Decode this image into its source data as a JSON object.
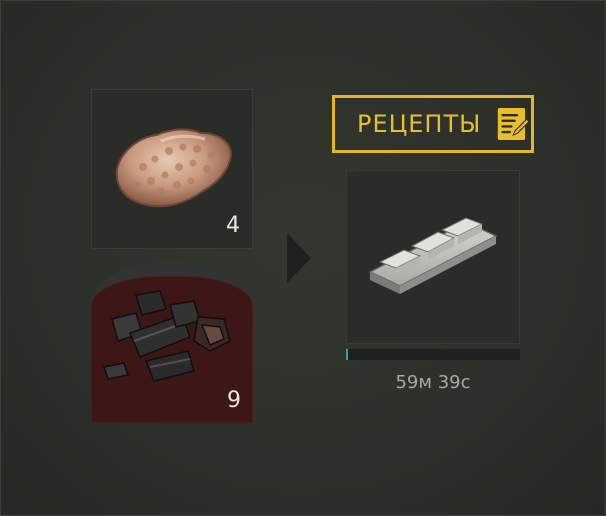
{
  "crafting": {
    "input_slots": [
      {
        "item": "ore",
        "icon": "ore-rock-icon",
        "count": "4"
      },
      {
        "item": "coal",
        "icon": "coal-icon",
        "count": "9"
      }
    ],
    "arrow_icon": "arrow-right-icon",
    "recipes_button": {
      "label": "РЕЦЕПТЫ",
      "icon": "recipe-note-pencil-icon"
    },
    "output_slot": {
      "item": "metal-bar",
      "icon": "metal-ingot-icon"
    },
    "progress": {
      "fraction": 0.01,
      "time_remaining": "59м 39с"
    }
  },
  "colors": {
    "accent": "#e0b828",
    "progress": "#2ea9a0",
    "fuel_slot": "#3d1717",
    "background": "#2d302a"
  }
}
